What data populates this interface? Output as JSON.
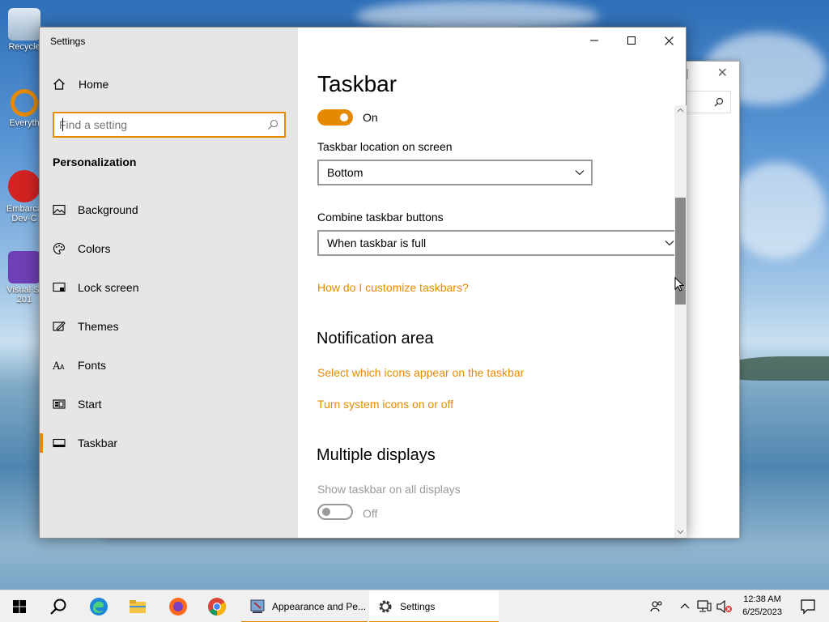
{
  "desktop": {
    "icons": [
      {
        "label": "Recycle"
      },
      {
        "label": "Everyth"
      },
      {
        "label": "Embarca Dev-C"
      },
      {
        "label": "Visual St 201"
      }
    ]
  },
  "settings": {
    "window_title": "Settings",
    "sidebar": {
      "home_label": "Home",
      "search_placeholder": "Find a setting",
      "section_title": "Personalization",
      "items": [
        {
          "label": "Background",
          "icon": "picture-icon"
        },
        {
          "label": "Colors",
          "icon": "palette-icon"
        },
        {
          "label": "Lock screen",
          "icon": "lock-screen-icon"
        },
        {
          "label": "Themes",
          "icon": "themes-icon"
        },
        {
          "label": "Fonts",
          "icon": "fonts-icon"
        },
        {
          "label": "Start",
          "icon": "start-icon"
        },
        {
          "label": "Taskbar",
          "icon": "taskbar-icon"
        }
      ]
    },
    "content": {
      "page_title": "Taskbar",
      "top_toggle": {
        "state": "On"
      },
      "location_label": "Taskbar location on screen",
      "location_value": "Bottom",
      "combine_label": "Combine taskbar buttons",
      "combine_value": "When taskbar is full",
      "customize_link": "How do I customize taskbars?",
      "notification_heading": "Notification area",
      "select_icons_link": "Select which icons appear on the taskbar",
      "system_icons_link": "Turn system icons on or off",
      "multiple_heading": "Multiple displays",
      "show_all_label": "Show taskbar on all displays",
      "show_all_state": "Off"
    }
  },
  "taskbar": {
    "apps": [
      {
        "label": "Appearance and Pe..."
      },
      {
        "label": "Settings"
      }
    ],
    "clock_time": "12:38 AM",
    "clock_date": "6/25/2023"
  },
  "colors": {
    "accent": "#e58a00",
    "sidebar_bg": "#e6e6e6"
  }
}
